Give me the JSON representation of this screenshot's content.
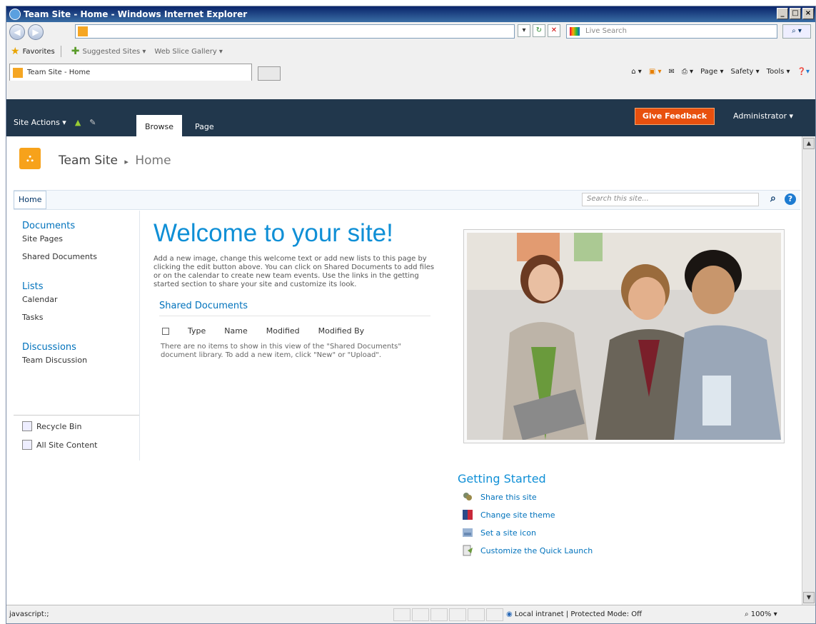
{
  "window": {
    "title": "Team Site - Home - Windows Internet Explorer"
  },
  "browser": {
    "live_search_placeholder": "Live Search",
    "favorites_label": "Favorites",
    "suggested_sites": "Suggested Sites ▾",
    "web_slice_gallery": "Web Slice Gallery ▾",
    "tab_title": "Team Site - Home",
    "commands": {
      "page": "Page ▾",
      "safety": "Safety ▾",
      "tools": "Tools ▾"
    }
  },
  "ribbon": {
    "site_actions": "Site Actions ▾",
    "tabs": [
      {
        "label": "Browse"
      },
      {
        "label": "Page"
      }
    ],
    "give_feedback": "Give Feedback",
    "user": "Administrator ▾"
  },
  "site": {
    "title": "Team Site",
    "separator": "▸",
    "current": "Home",
    "nav_home": "Home",
    "search_placeholder": "Search this site..."
  },
  "quick_launch": {
    "documents": "Documents",
    "site_pages": "Site Pages",
    "shared_documents": "Shared Documents",
    "lists": "Lists",
    "calendar": "Calendar",
    "tasks": "Tasks",
    "discussions": "Discussions",
    "team_discussion": "Team Discussion",
    "recycle_bin": "Recycle Bin",
    "all_site_content": "All Site Content"
  },
  "main": {
    "welcome": "Welcome to your site!",
    "intro": "Add a new image, change this welcome text or add new lists to this page by clicking the edit button above. You can click on Shared Documents to add files or on the calendar to create new team events. Use the links in the getting started section to share your site and customize its look.",
    "shared_docs_title": "Shared Documents",
    "columns": {
      "type": "Type",
      "name": "Name",
      "modified": "Modified",
      "modified_by": "Modified By"
    },
    "empty_message": "There are no items to show in this view of the \"Shared Documents\" document library. To add a new item, click \"New\" or \"Upload\"."
  },
  "getting_started": {
    "title": "Getting Started",
    "items": [
      {
        "label": "Share this site",
        "icon": "share-icon"
      },
      {
        "label": "Change site theme",
        "icon": "theme-icon"
      },
      {
        "label": "Set a site icon",
        "icon": "site-icon-icon"
      },
      {
        "label": "Customize the Quick Launch",
        "icon": "customize-icon"
      }
    ]
  },
  "status": {
    "text": "javascript:;",
    "zone": "Local intranet | Protected Mode: Off",
    "zoom": "100%"
  },
  "colors": {
    "ribbon": "#21374c",
    "feedback": "#e8500e",
    "link": "#0072bc",
    "heading": "#0f8fd6"
  }
}
